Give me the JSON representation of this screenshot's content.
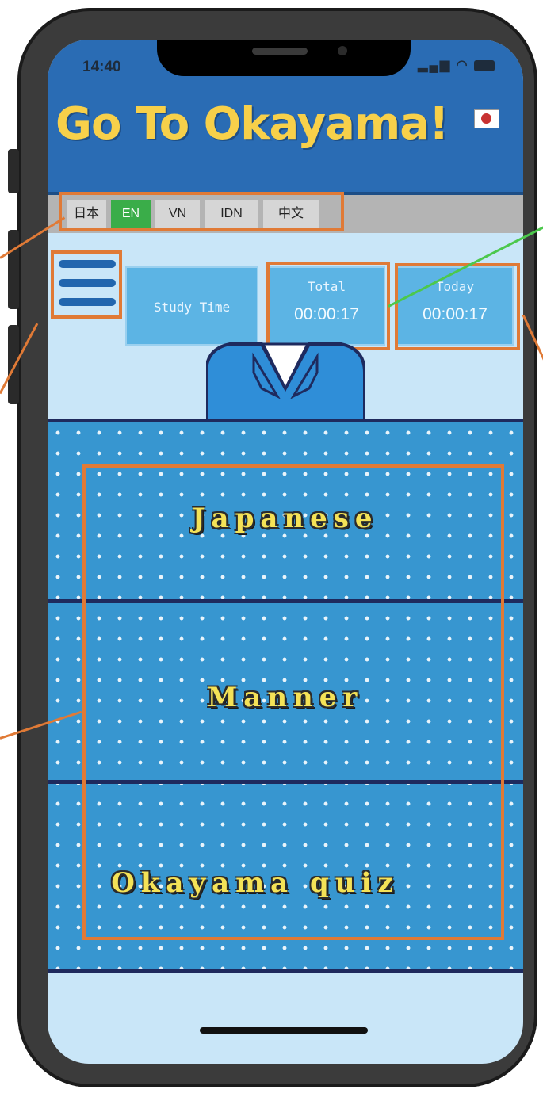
{
  "status_bar": {
    "time": "14:40",
    "icons": "••• ◔ ▮"
  },
  "header": {
    "title": "Go To Okayama!"
  },
  "languages": [
    {
      "label": "日本",
      "active": false
    },
    {
      "label": "EN",
      "active": true
    },
    {
      "label": "VN",
      "active": false
    },
    {
      "label": "IDN",
      "active": false
    },
    {
      "label": "中文",
      "active": false
    }
  ],
  "study": {
    "label": "Study Time",
    "total": {
      "label": "Total",
      "value": "00:00:17"
    },
    "today": {
      "label": "Today",
      "value": "00:00:17"
    }
  },
  "menu": {
    "items": [
      {
        "label": "Japanese"
      },
      {
        "label": "Manner"
      },
      {
        "label": "Okayama quiz"
      }
    ]
  },
  "colors": {
    "header_bg": "#2a6cb4",
    "title": "#f7d04a",
    "active_lang": "#3aad49",
    "annotation": "#e07a36",
    "annotation_green": "#4cc84c"
  },
  "icons": {
    "menu": "hamburger-icon",
    "flag": "japan-flag-icon"
  }
}
